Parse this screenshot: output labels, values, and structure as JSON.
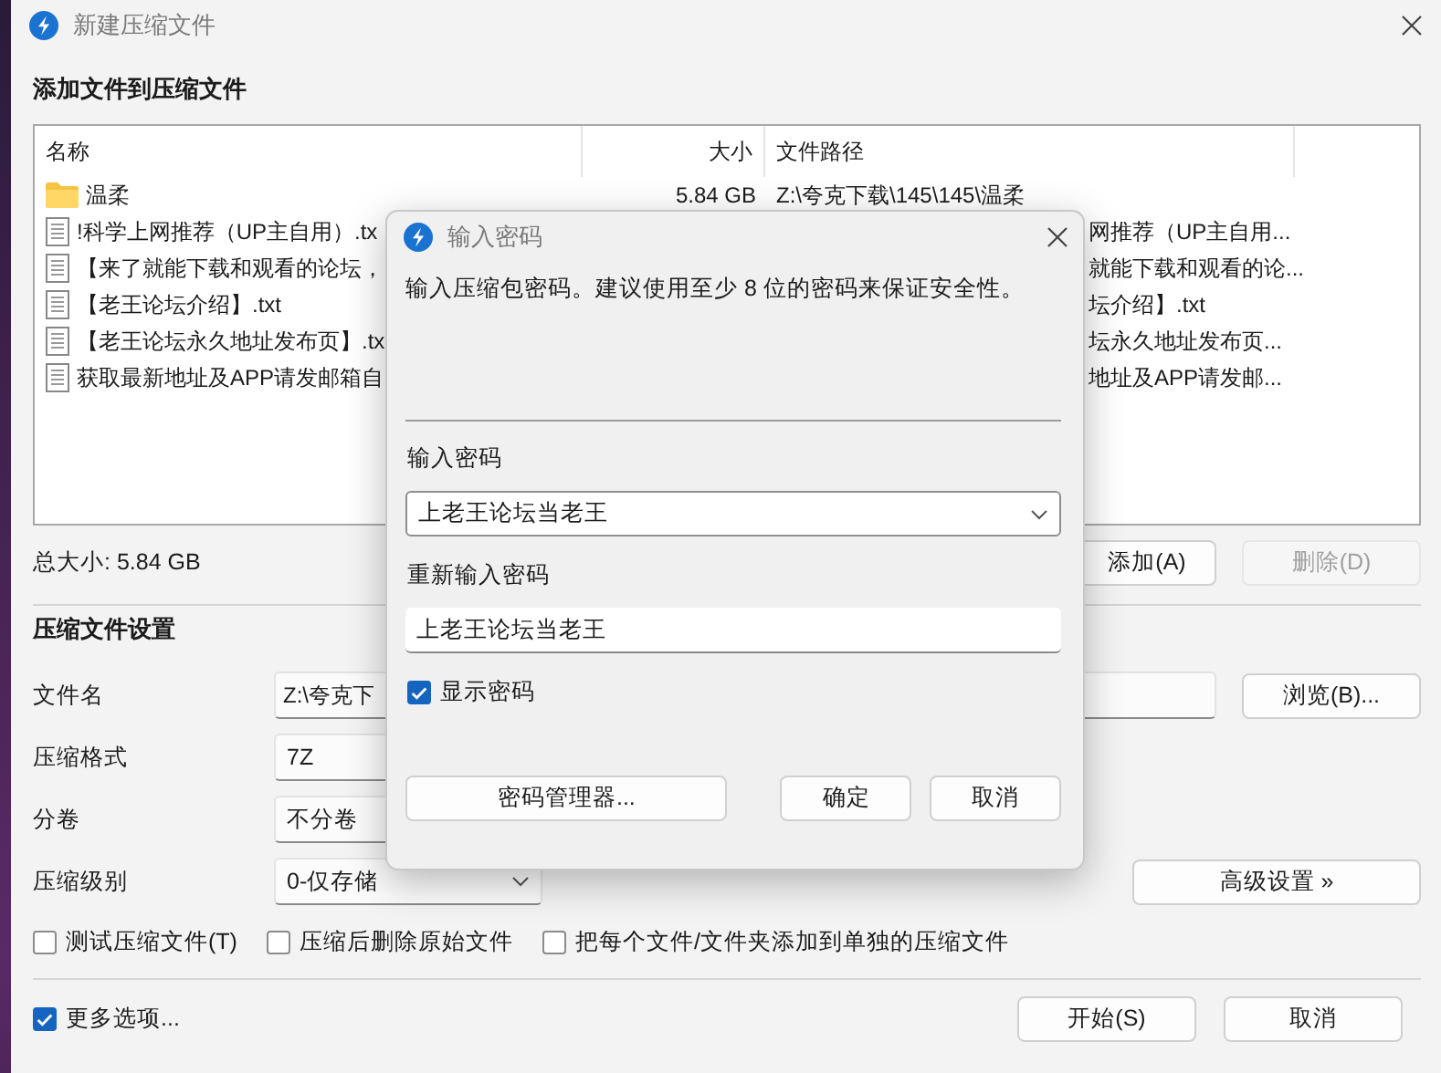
{
  "window": {
    "title": "新建压缩文件"
  },
  "files": {
    "heading": "添加文件到压缩文件",
    "columns": [
      "名称",
      "大小",
      "文件路径"
    ],
    "rows": [
      {
        "kind": "folder",
        "name": "温柔",
        "size": "5.84 GB",
        "path": "Z:\\夸克下载\\145\\145\\温柔"
      },
      {
        "kind": "file",
        "name": "!科学上网推荐（UP主自用）.tx",
        "path": "网推荐（UP主自用..."
      },
      {
        "kind": "file",
        "name": "【来了就能下载和观看的论坛，",
        "path": "就能下载和观看的论..."
      },
      {
        "kind": "file",
        "name": "【老王论坛介绍】.txt",
        "path": "坛介绍】.txt"
      },
      {
        "kind": "file",
        "name": "【老王论坛永久地址发布页】.tx",
        "path": "坛永久地址发布页..."
      },
      {
        "kind": "file",
        "name": "获取最新地址及APP请发邮箱自",
        "path": "地址及APP请发邮..."
      }
    ],
    "total": "总大小: 5.84 GB",
    "buttons": [
      {
        "label": "添加(A)",
        "disabled": false
      },
      {
        "label": "删除(D)",
        "disabled": true
      }
    ]
  },
  "settings": {
    "heading": "压缩文件设置",
    "rows": [
      {
        "kind": "text",
        "label": "文件名",
        "value": "Z:\\夸克下",
        "button": "浏览(B)..."
      },
      {
        "kind": "select",
        "label": "压缩格式",
        "value": "7Z"
      },
      {
        "kind": "select",
        "label": "分卷",
        "value": "不分卷"
      },
      {
        "kind": "select",
        "label": "压缩级别",
        "value": "0-仅存储",
        "button": "高级设置 »"
      }
    ],
    "options": [
      {
        "label": "测试压缩文件(T)",
        "checked": false
      },
      {
        "label": "压缩后删除原始文件",
        "checked": false
      },
      {
        "label": "把每个文件/文件夹添加到单独的压缩文件",
        "checked": false
      }
    ]
  },
  "footer": {
    "more_options": {
      "label": "更多选项...",
      "checked": true
    },
    "buttons": [
      "开始(S)",
      "取消"
    ]
  },
  "dialog": {
    "title": "输入密码",
    "message": "输入压缩包密码。建议使用至少 8 位的密码来保证安全性。",
    "password_label": "输入密码",
    "password": "上老王论坛当老王",
    "confirm_label": "重新输入密码",
    "confirm": "上老王论坛当老王",
    "show_password": {
      "label": "显示密码",
      "checked": true
    },
    "buttons": [
      "密码管理器...",
      "确定",
      "取消"
    ]
  }
}
